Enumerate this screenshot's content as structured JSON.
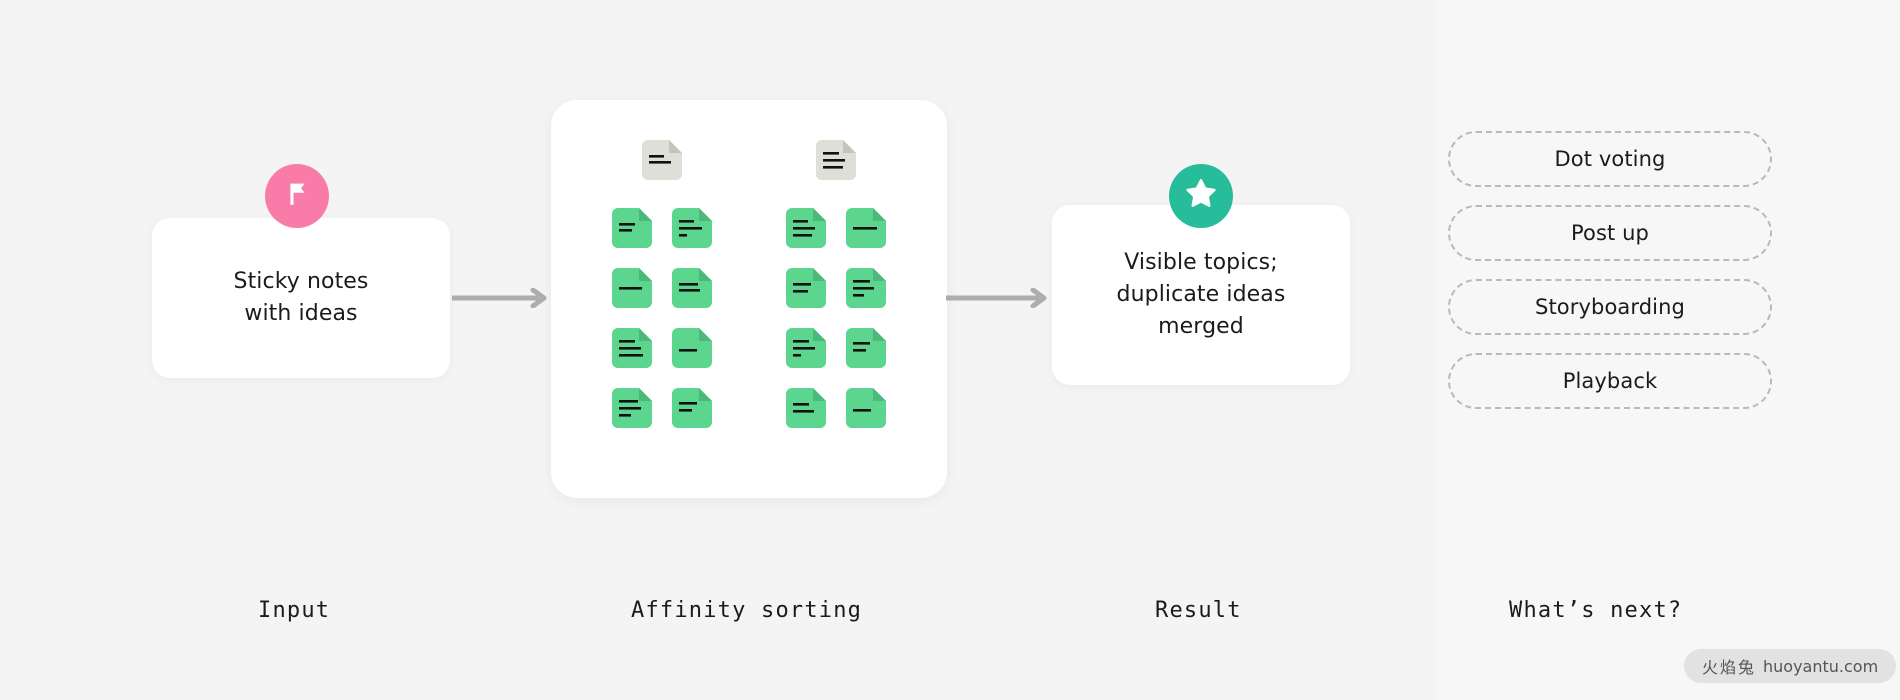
{
  "theme": {
    "background": "#f4f4f4",
    "right_panel_background": "#f7f7f7",
    "card_background": "#ffffff",
    "flag_badge_color": "#f97ca8",
    "star_badge_color": "#27bd9a",
    "note_green": "#5cd68f",
    "note_green_fold": "#4cb87a",
    "note_gray": "#dedfd6",
    "note_gray_fold": "#c3c4ba",
    "note_line_color": "#111111",
    "arrow_color": "#adadad",
    "pill_border_color": "#b9b9b9",
    "text_color": "#1b1b1b",
    "watermark_background": "#e2e2e2",
    "watermark_text_color": "#555555"
  },
  "stages": {
    "input": {
      "badge_icon": "flag-icon",
      "badge_color": "#f97ca8",
      "card_text": "Sticky notes\nwith ideas",
      "card_line_1": "Sticky notes",
      "card_line_2": "with ideas",
      "section_label": "Input"
    },
    "affinity": {
      "section_label": "Affinity sorting",
      "columns": [
        {
          "header_note": {
            "color": "gray",
            "lines": 2
          },
          "notes": [
            {
              "color": "green",
              "lines": 2
            },
            {
              "color": "green",
              "lines": 3
            },
            {
              "color": "green",
              "lines": 1
            },
            {
              "color": "green",
              "lines": 2
            },
            {
              "color": "green",
              "lines": 3
            },
            {
              "color": "green",
              "lines": 1
            },
            {
              "color": "green",
              "lines": 3
            },
            {
              "color": "green",
              "lines": 2
            }
          ]
        },
        {
          "header_note": {
            "color": "gray",
            "lines": 3
          },
          "notes": [
            {
              "color": "green",
              "lines": 3
            },
            {
              "color": "green",
              "lines": 1
            },
            {
              "color": "green",
              "lines": 2
            },
            {
              "color": "green",
              "lines": 3
            },
            {
              "color": "green",
              "lines": 3
            },
            {
              "color": "green",
              "lines": 2
            },
            {
              "color": "green",
              "lines": 2
            },
            {
              "color": "green",
              "lines": 1
            }
          ]
        }
      ]
    },
    "result": {
      "badge_icon": "star-icon",
      "badge_color": "#27bd9a",
      "card_line_1": "Visible topics;",
      "card_line_2": "duplicate ideas",
      "card_line_3": "merged",
      "section_label": "Result"
    },
    "next": {
      "section_label": "What’s next?",
      "pills": [
        {
          "label": "Dot voting"
        },
        {
          "label": "Post up"
        },
        {
          "label": "Storyboarding"
        },
        {
          "label": "Playback"
        }
      ]
    }
  },
  "arrows": [
    {
      "name": "arrow-input-to-sorting",
      "direction": "right"
    },
    {
      "name": "arrow-sorting-to-result",
      "direction": "right"
    }
  ],
  "watermark": {
    "brand_cn": "火焰兔",
    "domain": "huoyantu.com"
  }
}
